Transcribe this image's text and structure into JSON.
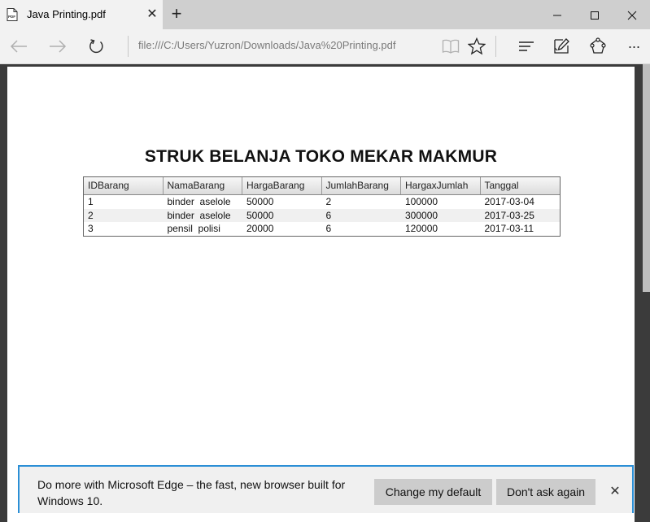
{
  "tab": {
    "title": "Java Printing.pdf",
    "close_glyph": "✕",
    "new_glyph": "+"
  },
  "window": {
    "minimize": "—",
    "maximize": "☐",
    "close": "✕"
  },
  "address": {
    "url": "file:///C:/Users/Yuzron/Downloads/Java%20Printing.pdf"
  },
  "toolbar": {
    "more_glyph": "···"
  },
  "document": {
    "title": "STRUK BELANJA TOKO MEKAR MAKMUR",
    "columns": [
      "IDBarang",
      "NamaBarang",
      "HargaBarang",
      "JumlahBarang",
      "HargaxJumlah",
      "Tanggal"
    ],
    "rows": [
      [
        "1",
        "binder  aselole",
        "50000",
        "2",
        "100000",
        "2017-03-04"
      ],
      [
        "2",
        "binder  aselole",
        "50000",
        "6",
        "300000",
        "2017-03-25"
      ],
      [
        "3",
        "pensil  polisi",
        "20000",
        "6",
        "120000",
        "2017-03-11"
      ]
    ]
  },
  "notification": {
    "message": "Do more with Microsoft Edge – the fast, new browser built for Windows 10.",
    "primary_label": "Change my default",
    "secondary_label": "Don't ask again",
    "close_glyph": "✕"
  },
  "colors": {
    "accent": "#2b8fd6",
    "tab_bg": "#f2f2f2",
    "titlebar_bg": "#cfcfcf",
    "viewer_bg": "#3b3b3b"
  }
}
